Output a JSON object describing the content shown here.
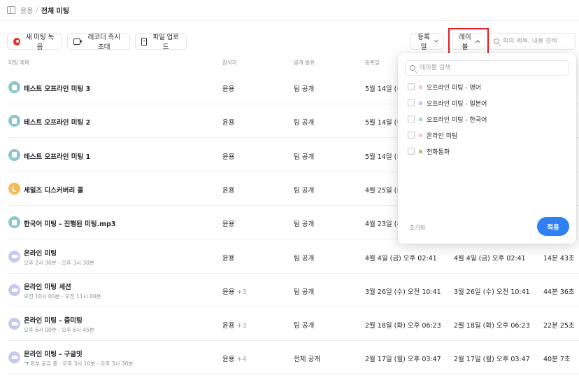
{
  "breadcrumb": {
    "parent": "윤용",
    "separator": "/",
    "current": "전체 미팅"
  },
  "toolbar": {
    "new_recording": "새 미팅 녹음",
    "invite_recorder": "레코더 즉시 초대",
    "upload_file": "파일 업로드",
    "sort_label": "등록일",
    "label_filter": "레이블",
    "search_placeholder": "회의 제목, 내용 검색"
  },
  "table": {
    "headers": {
      "title": "미팅 제목",
      "participants": "참석자",
      "visibility": "공개 범위",
      "registered": "등록일"
    },
    "rows": [
      {
        "icon": "document-icon",
        "title": "테스트 오프라인 미팅 3",
        "subtitle": "",
        "participant": "윤용",
        "extra": "",
        "visibility": "팀 공개",
        "registered": "5월 14일 (수)",
        "date2": "",
        "duration": ""
      },
      {
        "icon": "document-icon",
        "title": "테스트 오프라인 미팅 2",
        "subtitle": "",
        "participant": "윤용",
        "extra": "",
        "visibility": "팀 공개",
        "registered": "5월 14일 (수)",
        "date2": "",
        "duration": ""
      },
      {
        "icon": "document-icon",
        "title": "테스트 오프라인 미팅 1",
        "subtitle": "",
        "participant": "윤용",
        "extra": "",
        "visibility": "팀 공개",
        "registered": "5월 14일 (수)",
        "date2": "",
        "duration": ""
      },
      {
        "icon": "moon-icon",
        "title": "세일즈 디스커버리 콜",
        "subtitle": "",
        "participant": "윤용",
        "extra": "",
        "visibility": "팀 공개",
        "registered": "4월 25일 (금)",
        "date2": "",
        "duration": ""
      },
      {
        "icon": "document-icon",
        "title": "한국어 미팅 - 진행된 미팅.mp3",
        "subtitle": "",
        "participant": "윤용",
        "extra": "",
        "visibility": "팀 공개",
        "registered": "4월 23일 (수)",
        "date2": "",
        "duration": ""
      },
      {
        "icon": "video-icon",
        "title": "온라인 미팅",
        "subtitle": "오후 2시 30분 - 오후 3시 30분",
        "participant": "윤용",
        "extra": "",
        "visibility": "팀 공개",
        "registered": "4월 4일 (금) 오후 02:41",
        "date2": "4월 4일 (금) 오후 02:41",
        "duration": "14분 43초"
      },
      {
        "icon": "video-icon",
        "title": "온라인 미팅 세션",
        "subtitle": "오전 10시 00분 - 오전 11시 00분",
        "participant": "윤용",
        "extra": "+3",
        "visibility": "팀 공개",
        "registered": "3월 26일 (수) 오전 10:41",
        "date2": "3월 26일 (수) 오전 10:41",
        "duration": "44분 36초"
      },
      {
        "icon": "video-icon",
        "title": "온라인 미팅 - 줌미팅",
        "subtitle": "오후 6시 00분 - 오후 6시 45분",
        "participant": "윤용",
        "extra": "+3",
        "visibility": "팀 공개",
        "registered": "2월 18일 (화) 오후 06:23",
        "date2": "2월 18일 (화) 오후 06:23",
        "duration": "22분 25초"
      },
      {
        "icon": "video-icon",
        "title": "온라인 미팅 - 구글밋",
        "subtitle": "외부 공유 중 · 오후 3시 10분 - 오후 3시 30분",
        "participant": "윤용",
        "extra": "+4",
        "visibility": "전체 공개",
        "registered": "2월 17일 (월) 오후 03:47",
        "date2": "2월 17일 (월) 오후 03:47",
        "duration": "40분 7초"
      }
    ]
  },
  "label_dropdown": {
    "search_placeholder": "레이블 검색",
    "options": [
      {
        "label": "오프라인 미팅 - 영어",
        "color": "#f2c4cf",
        "checked": false
      },
      {
        "label": "오프라인 미팅 - 일본어",
        "color": "#b9c8f2",
        "checked": false
      },
      {
        "label": "오프라인 미팅 - 한국어",
        "color": "#a9e3b0",
        "checked": false
      },
      {
        "label": "온라인 미팅",
        "color": "#f2c4cf",
        "checked": false
      },
      {
        "label": "전화통화",
        "color": "#c9b86a",
        "checked": false
      }
    ],
    "reset": "초기화",
    "apply": "적용"
  },
  "colors": {
    "record": "#e5312b",
    "apply_button": "#2f7ff5",
    "highlight_border": "#e01e24"
  }
}
